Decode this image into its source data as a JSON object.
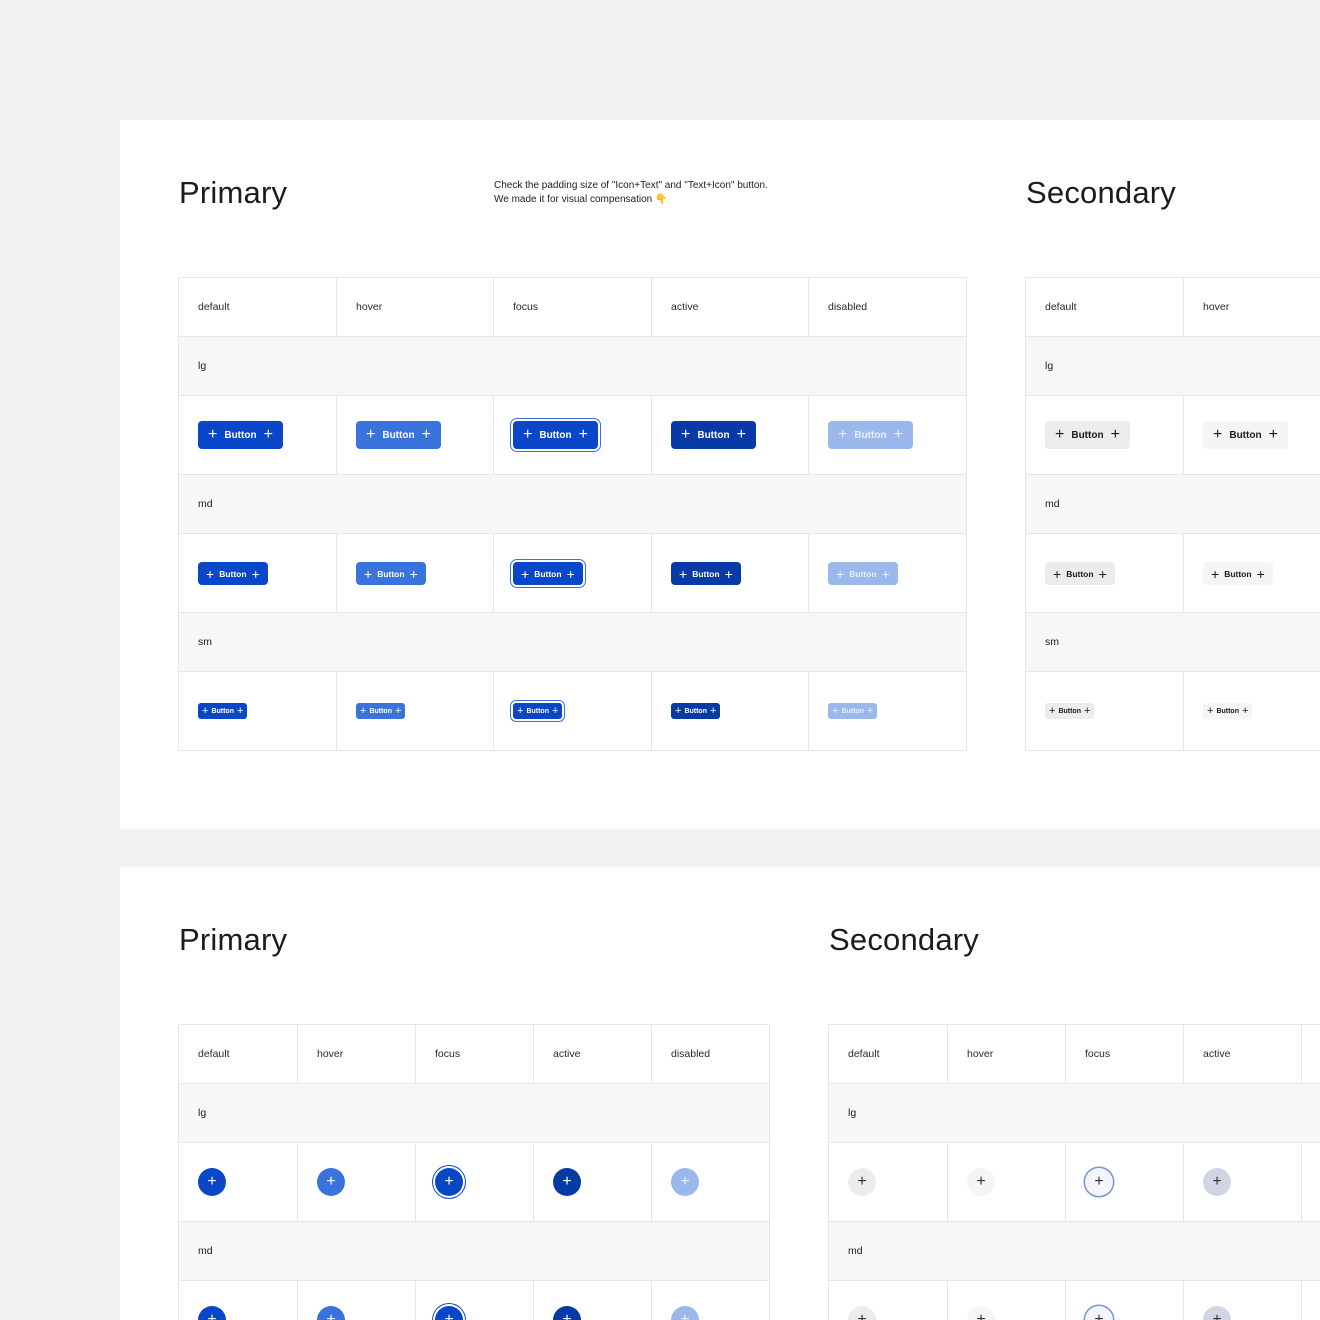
{
  "colors": {
    "primary": "#0a47c8",
    "primary_hover": "#3b73dd",
    "primary_active": "#083aa6",
    "primary_disabled": "#9bb8ed",
    "secondary": "#ececec",
    "canvas": "#f2f2f2"
  },
  "plus_glyph": "+",
  "button_label": "Button",
  "panel1": {
    "primary_title": "Primary",
    "secondary_title": "Secondary",
    "note_line1": "Check the padding size of \"Icon+Text\" and \"Text+Icon\" button.",
    "note_line2": "We made it for visual compensation 👇",
    "primary_states": [
      "default",
      "hover",
      "focus",
      "active",
      "disabled"
    ],
    "secondary_states": [
      "default",
      "hover"
    ],
    "sizes": [
      "lg",
      "md",
      "sm"
    ]
  },
  "panel2": {
    "primary_title": "Primary",
    "secondary_title": "Secondary",
    "primary_states": [
      "default",
      "hover",
      "focus",
      "active",
      "disabled"
    ],
    "secondary_states": [
      "default",
      "hover",
      "focus",
      "active"
    ],
    "sizes": [
      "lg",
      "md"
    ]
  }
}
